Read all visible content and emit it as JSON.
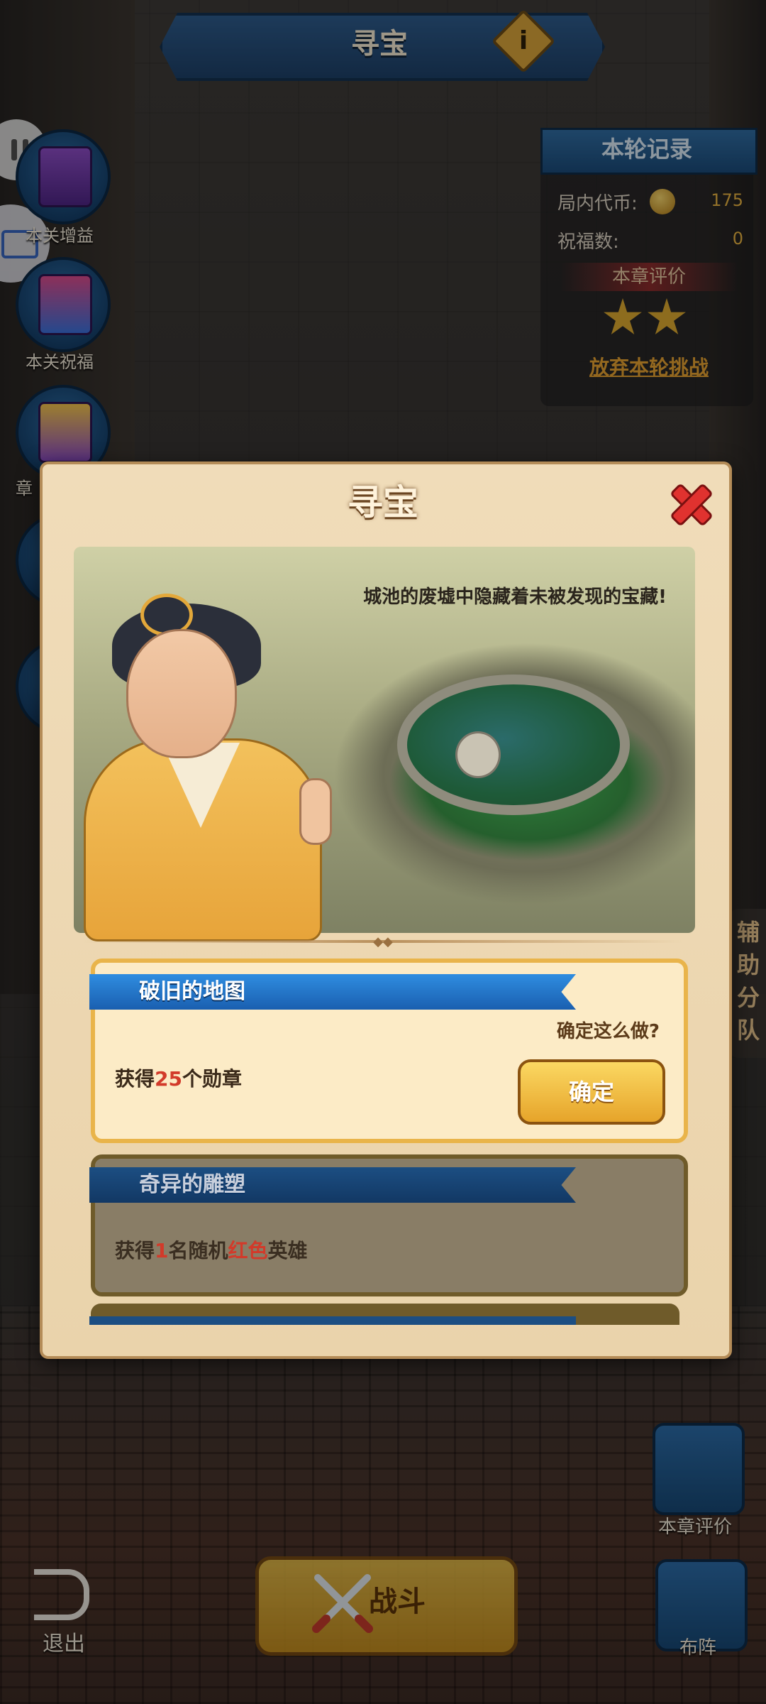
{
  "header": {
    "title": "寻宝",
    "info_icon": "info-icon"
  },
  "left_menu": [
    {
      "label": "本关增益",
      "icon": "buff-book-icon"
    },
    {
      "label": "本关祝福",
      "icon": "blessing-cards-icon"
    },
    {
      "label": "章",
      "icon": "chapter-icon"
    },
    {
      "label": "",
      "icon": "partial-icon"
    },
    {
      "label": "",
      "icon": "partial-icon"
    }
  ],
  "record": {
    "title": "本轮记录",
    "coins_label": "局内代币:",
    "coins_value": "175",
    "blessings_label": "祝福数:",
    "blessings_value": "0",
    "chapter_rating_label": "本章评价",
    "stars": 2,
    "abandon_label": "放弃本轮挑战"
  },
  "side_tab": {
    "label": "辅助分队"
  },
  "dialog": {
    "title": "寻宝",
    "caption": "城池的废墟中隐藏着未被发现的宝藏!",
    "options": [
      {
        "title": "破旧的地图",
        "reward_prefix": "获得",
        "reward_num": "25",
        "reward_suffix": "个勋章",
        "confirm_question": "确定这么做?",
        "confirm_label": "确定"
      },
      {
        "title": "奇异的雕塑",
        "reward_prefix": "获得",
        "reward_num": "1",
        "reward_mid": "名随机",
        "reward_color": "红色",
        "reward_suffix": "英雄"
      }
    ]
  },
  "bottom": {
    "exit_label": "退出",
    "fight_label": "战斗",
    "chapter_rating_label": "本章评价",
    "formation_label": "布阵"
  },
  "colors": {
    "ribbon_blue": "#2f8de0",
    "gold": "#e6a42a",
    "highlight_red": "#d23a2a"
  }
}
